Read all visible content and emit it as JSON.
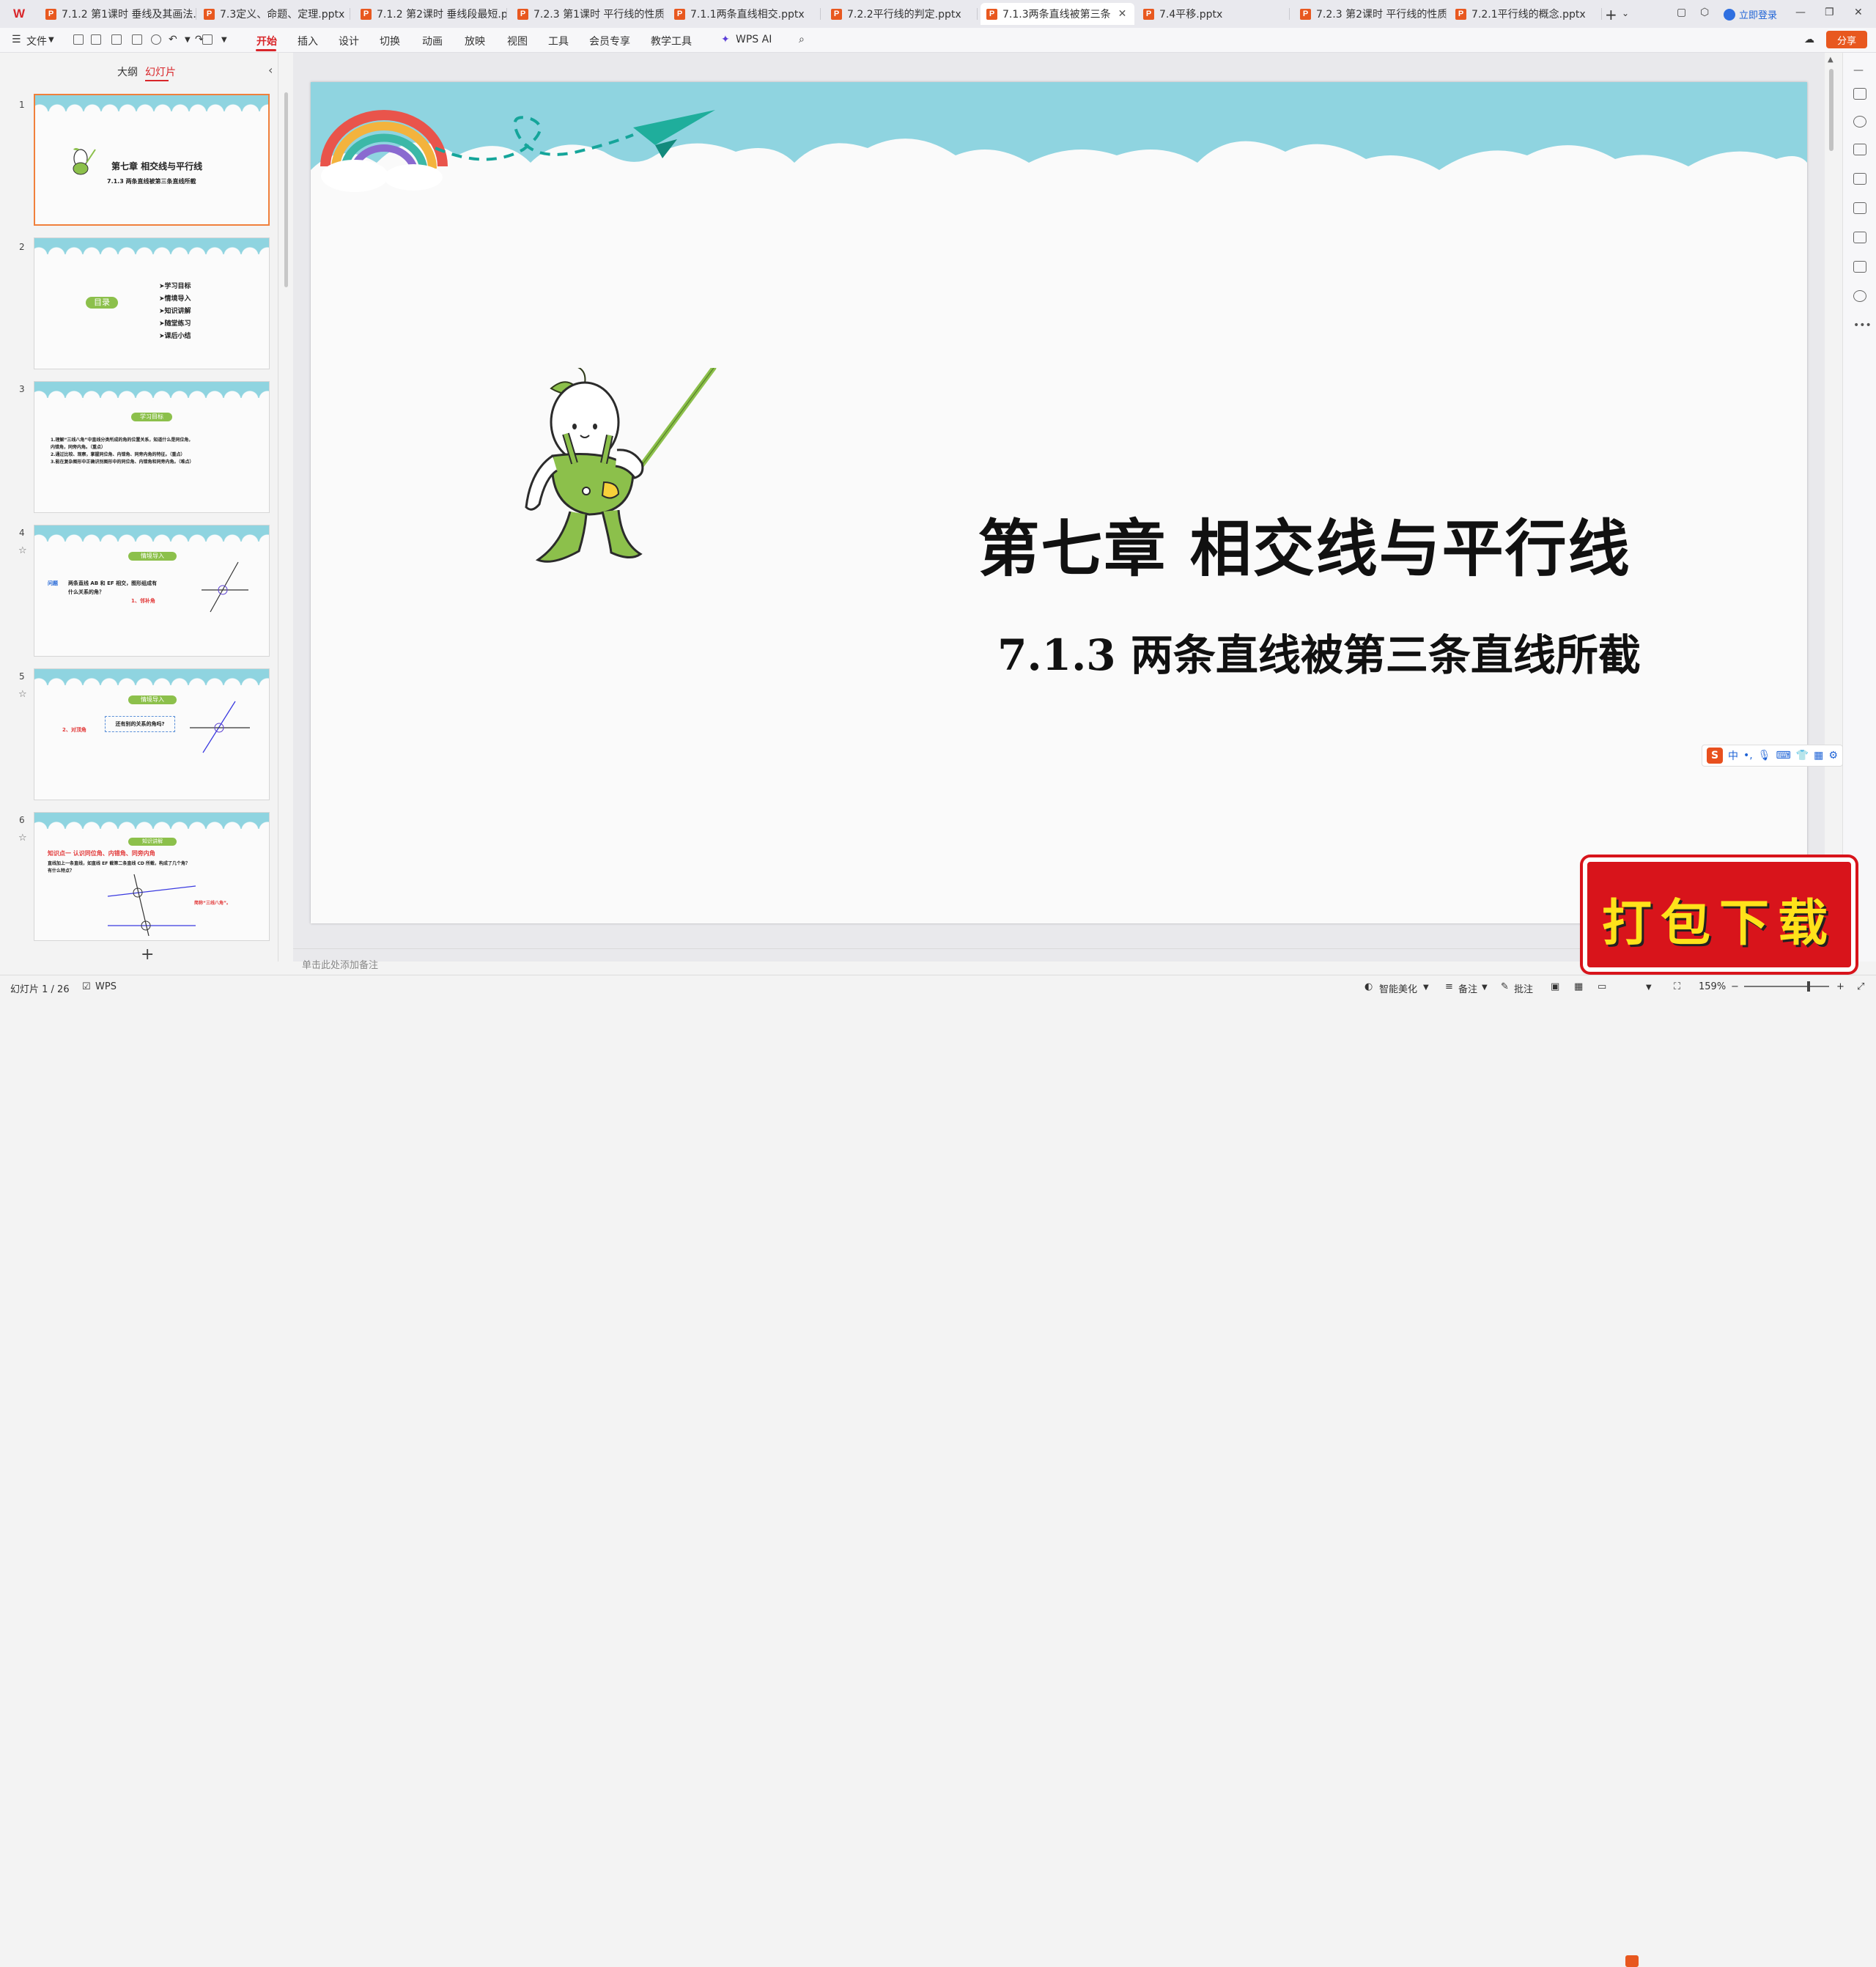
{
  "tabs": [
    {
      "label": "7.1.2 第1课时 垂线及其画法.pp"
    },
    {
      "label": "7.3定义、命题、定理.pptx"
    },
    {
      "label": "7.1.2 第2课时 垂线段最短.pptx"
    },
    {
      "label": "7.2.3 第1课时 平行线的性质.pp"
    },
    {
      "label": "7.1.1两条直线相交.pptx"
    },
    {
      "label": "7.2.2平行线的判定.pptx"
    },
    {
      "label": "7.1.3两条直线被第三条"
    },
    {
      "label": "7.4平移.pptx"
    },
    {
      "label": "7.2.3 第2课时 平行线的性质与"
    },
    {
      "label": "7.2.1平行线的概念.pptx"
    }
  ],
  "login_label": "立即登录",
  "menu": {
    "file": "文件",
    "items": [
      "开始",
      "插入",
      "设计",
      "切换",
      "动画",
      "放映",
      "视图",
      "工具",
      "会员专享",
      "教学工具"
    ],
    "ai": "WPS AI",
    "share": "分享"
  },
  "left_panel": {
    "tab_outline": "大纲",
    "tab_slides": "幻灯片"
  },
  "thumbnails": [
    {
      "num": "1",
      "title": "第七章  相交线与平行线",
      "sub": "7.1.3 两条直线被第三条直线所截"
    },
    {
      "num": "2",
      "badge": "目录",
      "items": [
        "➤学习目标",
        "➤情境导入",
        "➤知识讲解",
        "➤随堂练习",
        "➤课后小结"
      ]
    },
    {
      "num": "3",
      "badge": "学习目标",
      "lines": [
        "1.理解“三线八角”中直线分类所成的角的位置关系，知道什么是同位角，",
        "内错角，同旁内角。（重点）",
        "2.通过比较、观察，掌握同位角、内错角、同旁内角的特征。（重点）",
        "3.能在复杂图形中正确识别图形中的同位角、内错角和同旁内角。（难点）"
      ]
    },
    {
      "num": "4",
      "badge": "情境导入",
      "q_label": "问题",
      "q_text": "两条直线 AB 和 EF 相交，图形组成有",
      "q_text2": "什么关系的角？",
      "answer": "1、邻补角"
    },
    {
      "num": "5",
      "badge": "情境导入",
      "answer": "2、对顶角",
      "box_text": "还有别的关系的角吗?"
    },
    {
      "num": "6",
      "badge": "知识讲解",
      "heading": "知识点一  认识同位角、内错角、同旁内角",
      "line1": "直线加上一条直线，如直线 EF 截第二条直线 CD 所截，构成了几个角？",
      "line2": "有什么特点？",
      "note": "简称“三线八角”。"
    }
  ],
  "slide": {
    "title": "第七章  相交线与平行线",
    "subtitle": "7.1.3 两条直线被第三条直线所截"
  },
  "notes_placeholder": "单击此处添加备注",
  "ime_label": "中",
  "download_badge": "打包下载",
  "status": {
    "slide_count": "幻灯片 1 / 26",
    "app": "WPS",
    "beautify": "智能美化",
    "notes": "备注",
    "comments": "批注",
    "zoom": "159%"
  },
  "colors": {
    "accent_red": "#d9262a",
    "orange": "#e8581f",
    "sky": "#8fd4e0",
    "leaf_green": "#8cc04b"
  }
}
